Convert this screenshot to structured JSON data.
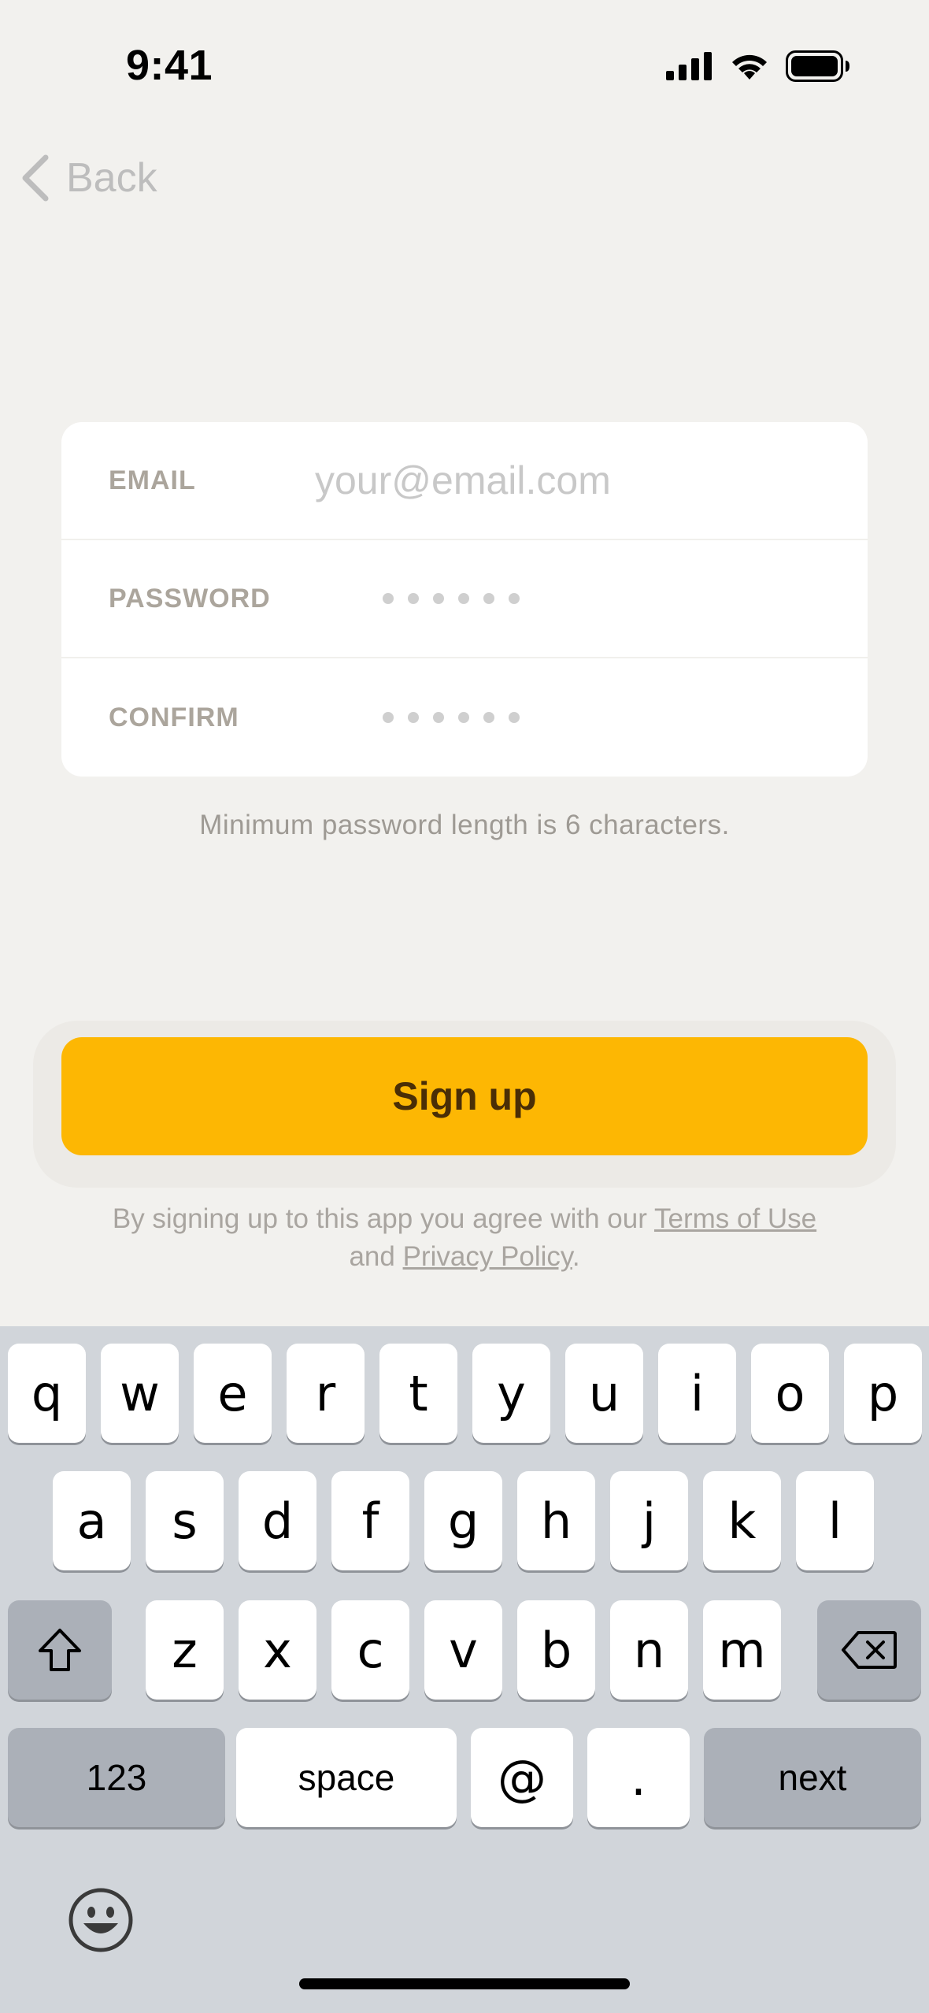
{
  "status_bar": {
    "time": "9:41",
    "icons": [
      "signal-icon",
      "wifi-icon",
      "battery-icon"
    ]
  },
  "nav": {
    "back_label": "Back",
    "back_icon": "chevron-left-icon"
  },
  "form": {
    "email": {
      "label": "EMAIL",
      "placeholder": "your@email.com",
      "value": ""
    },
    "password": {
      "label": "PASSWORD",
      "masked": "••••••"
    },
    "confirm": {
      "label": "CONFIRM",
      "masked": "••••••"
    }
  },
  "hint": "Minimum password length is 6 characters.",
  "signup": {
    "label": "Sign up",
    "color": "#FDB703"
  },
  "terms": {
    "prefix": "By signing up to this app you agree with our",
    "terms_link": "Terms of Use",
    "middle": "and",
    "privacy_link": "Privacy Policy",
    "suffix": "."
  },
  "keyboard": {
    "row1": [
      "q",
      "w",
      "e",
      "r",
      "t",
      "y",
      "u",
      "i",
      "o",
      "p"
    ],
    "row2": [
      "a",
      "s",
      "d",
      "f",
      "g",
      "h",
      "j",
      "k",
      "l"
    ],
    "row3": [
      "z",
      "x",
      "c",
      "v",
      "b",
      "n",
      "m"
    ],
    "shift_icon": "shift-icon",
    "delete_icon": "delete-icon",
    "numbers_label": "123",
    "space_label": "space",
    "at_label": "@",
    "dot_label": ".",
    "next_label": "next",
    "emoji_icon": "emoji-icon"
  }
}
